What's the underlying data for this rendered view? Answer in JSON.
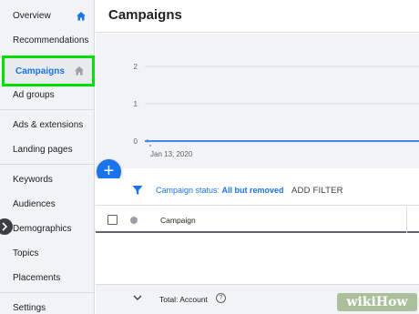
{
  "sidebar": {
    "items": [
      {
        "label": "Overview",
        "icon": "home-icon"
      },
      {
        "label": "Recommendations"
      },
      {
        "label": "Campaigns",
        "icon": "home-icon",
        "active": true
      },
      {
        "label": "Ad groups"
      },
      {
        "label": "Ads & extensions"
      },
      {
        "label": "Landing pages"
      },
      {
        "label": "Keywords"
      },
      {
        "label": "Audiences"
      },
      {
        "label": "Demographics"
      },
      {
        "label": "Topics"
      },
      {
        "label": "Placements"
      },
      {
        "label": "Settings"
      }
    ],
    "highlight_color": "#00e000"
  },
  "header": {
    "title": "Campaigns"
  },
  "chart_data": {
    "type": "line",
    "x": [
      "Jan 13, 2020"
    ],
    "series": [
      {
        "values": [
          0
        ]
      }
    ],
    "yticks": [
      "2",
      "1",
      "0"
    ],
    "xticks": [
      "Jan 13, 2020"
    ],
    "ylim": [
      0,
      2
    ],
    "grid": true,
    "line_color": "#4285f4"
  },
  "fab": {
    "label": "+"
  },
  "filter": {
    "prefix": "Campaign status: ",
    "value": "All but removed",
    "add_label": "ADD FILTER"
  },
  "table": {
    "columns": [
      "Campaign"
    ],
    "total_label": "Total: Account",
    "help_glyph": "?"
  },
  "watermark": {
    "text": "wikiHow"
  },
  "colors": {
    "accent": "#1a73e8",
    "sidebar_bg": "#f1f3f4"
  }
}
